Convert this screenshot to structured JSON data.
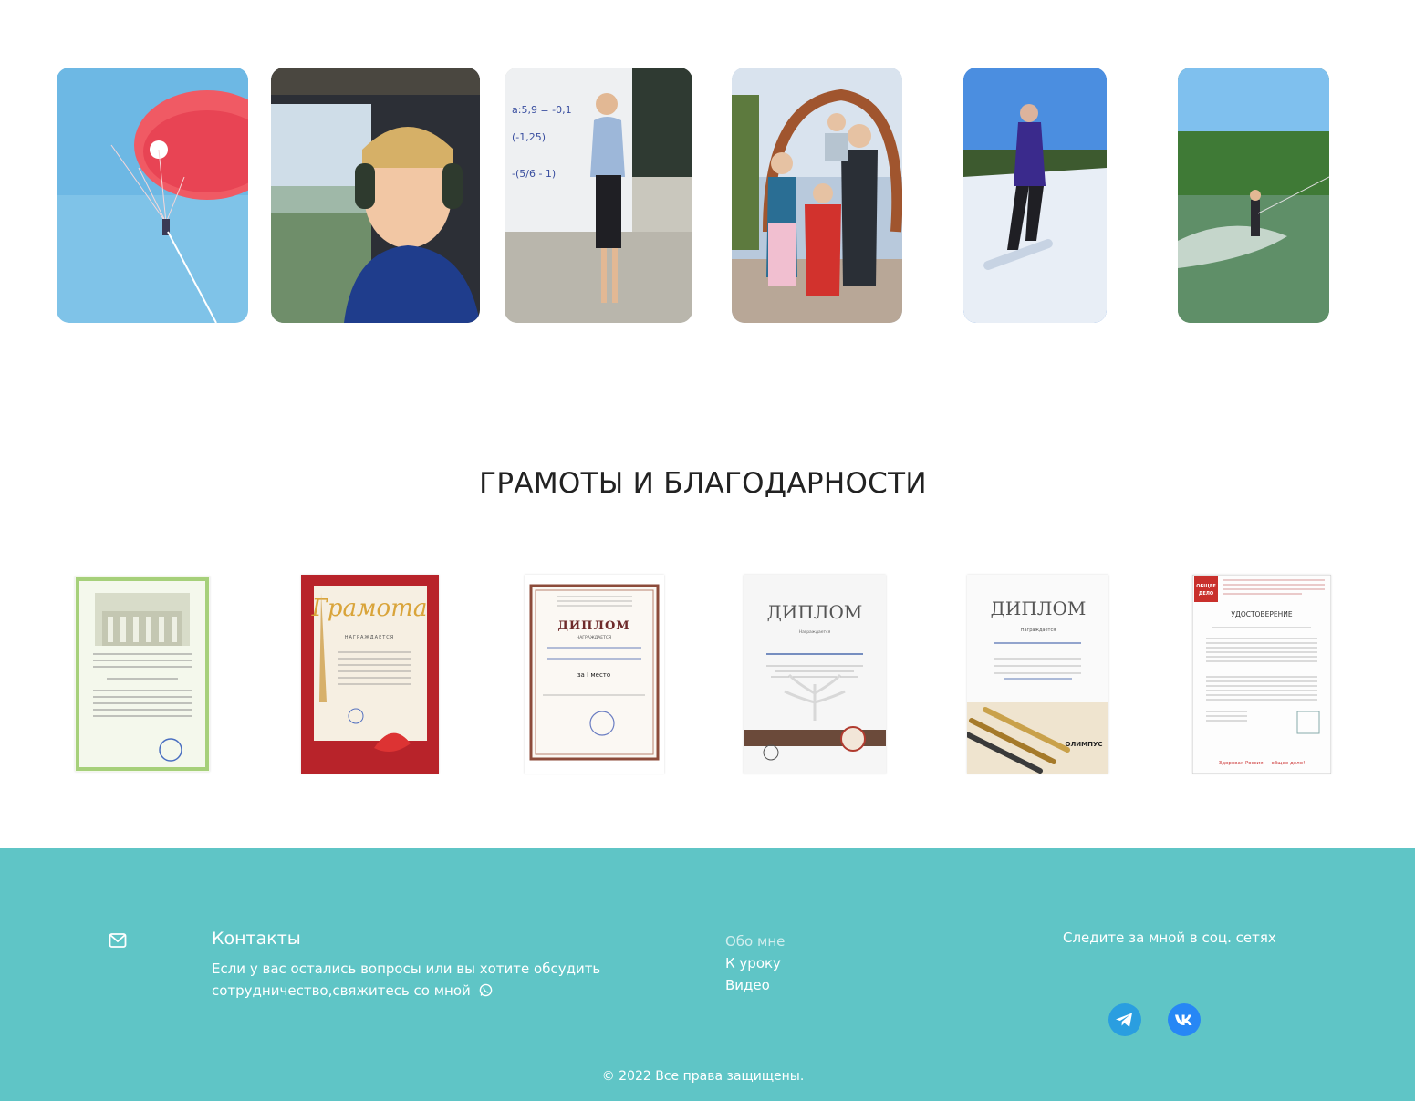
{
  "gallery": {
    "photos": [
      {
        "icon": "parasailing-photo"
      },
      {
        "icon": "helicopter-pilot-photo"
      },
      {
        "icon": "teacher-at-whiteboard-photo"
      },
      {
        "icon": "family-photo"
      },
      {
        "icon": "snowboarding-photo"
      },
      {
        "icon": "wakeboarding-photo"
      }
    ]
  },
  "awards": {
    "title": "ГРАМОТЫ И БЛАГОДАРНОСТИ",
    "certificates": [
      {
        "heading": "",
        "icon": "certificate-image"
      },
      {
        "heading": "Грамота",
        "subheading": "НАГРАЖДАЕТСЯ",
        "icon": "certificate-image"
      },
      {
        "heading": "ДИПЛОМ",
        "subheading": "НАГРАЖДАЕТСЯ",
        "icon": "certificate-image"
      },
      {
        "heading": "ДИПЛОМ",
        "subheading": "Награждается",
        "icon": "certificate-image"
      },
      {
        "heading": "ДИПЛОМ",
        "subheading": "Награждается",
        "icon": "certificate-image"
      },
      {
        "heading": "УДОСТОВЕРЕНИЕ",
        "subheading": "ОБЩЕЕ ДЕЛО",
        "icon": "certificate-image"
      }
    ]
  },
  "footer": {
    "contacts_title": "Контакты",
    "contacts_text": "Если у вас остались вопросы или вы хотите обсудить сотрудничество,свяжитесь со мной",
    "nav": [
      "Обо мне",
      "К уроку",
      "Видео"
    ],
    "social_title": "Следите за мной в соц. сетях",
    "social": [
      {
        "icon": "telegram-icon"
      },
      {
        "icon": "vk-icon"
      }
    ],
    "copyright": "© 2022 Все права защищены.",
    "colors": {
      "background": "#5fc5c6",
      "text": "#ffffff",
      "social_button": "#2a8fd9"
    }
  }
}
